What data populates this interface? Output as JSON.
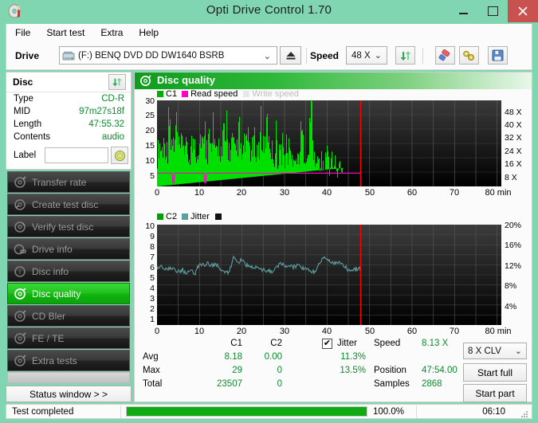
{
  "window": {
    "title": "Opti Drive Control 1.70",
    "icon": "disc-icon",
    "controls": {
      "minimize": "–",
      "maximize": "□",
      "close": "✕"
    }
  },
  "menu": {
    "items": [
      "File",
      "Start test",
      "Extra",
      "Help"
    ]
  },
  "toolbar": {
    "drive_label": "Drive",
    "drive_value": "(F:)   BENQ DVD DD DW1640 BSRB",
    "eject_title": "Eject",
    "speed_label": "Speed",
    "speed_value": "48 X",
    "refresh_icon": "refresh-icon",
    "eraser_icon": "eraser-icon",
    "tools_icon": "tools-icon",
    "save_icon": "floppy-save-icon"
  },
  "disc_panel": {
    "title": "Disc",
    "refresh_icon": "refresh-icon",
    "rows": [
      {
        "key": "Type",
        "value": "CD-R"
      },
      {
        "key": "MID",
        "value": "97m27s18f"
      },
      {
        "key": "Length",
        "value": "47:55.32"
      },
      {
        "key": "Contents",
        "value": "audio"
      }
    ],
    "label_key": "Label",
    "label_value": "",
    "label_placeholder": "",
    "label_button_icon": "cd-disc-icon"
  },
  "sidebar": {
    "items": [
      {
        "label": "Transfer rate",
        "icon": "disc-test-icon",
        "active": false
      },
      {
        "label": "Create test disc",
        "icon": "disc-burn-icon",
        "active": false
      },
      {
        "label": "Verify test disc",
        "icon": "disc-verify-icon",
        "active": false
      },
      {
        "label": "Drive info",
        "icon": "drive-info-icon",
        "active": false
      },
      {
        "label": "Disc info",
        "icon": "disc-info-icon",
        "active": false
      },
      {
        "label": "Disc quality",
        "icon": "disc-quality-icon",
        "active": true
      },
      {
        "label": "CD Bler",
        "icon": "cd-bler-icon",
        "active": false
      },
      {
        "label": "FE / TE",
        "icon": "fe-te-icon",
        "active": false
      },
      {
        "label": "Extra tests",
        "icon": "extra-tests-icon",
        "active": false
      }
    ],
    "status_window_button": "Status window > >"
  },
  "main": {
    "header_title": "Disc quality",
    "header_icon": "disc-quality-icon"
  },
  "stats": {
    "col_c1": "C1",
    "col_c2": "C2",
    "jitter_label": "Jitter",
    "jitter_checked": true,
    "jitter_check_glyph": "✔",
    "rows": [
      {
        "name": "Avg",
        "c1": "8.18",
        "c2": "0.00",
        "jitter": "11.3%"
      },
      {
        "name": "Max",
        "c1": "29",
        "c2": "0",
        "jitter": "13.5%"
      },
      {
        "name": "Total",
        "c1": "23507",
        "c2": "0",
        "jitter": ""
      }
    ],
    "speed_label": "Speed",
    "speed_value": "8.13 X",
    "position_label": "Position",
    "position_value": "47:54.00",
    "samples_label": "Samples",
    "samples_value": "2868",
    "clv_value": "8 X CLV",
    "start_full": "Start full",
    "start_part": "Start part"
  },
  "statusbar": {
    "text": "Test completed",
    "progress_pct_label": "100.0%",
    "progress_pct": 100,
    "elapsed": "06:10"
  },
  "colors": {
    "accent_green": "#00e000",
    "jitter_teal": "#5f9ea0",
    "read_speed_magenta": "#ff00c8",
    "cursor_red": "#ff0000",
    "titlebar": "#7fd6b0",
    "value_green": "#0d8a2e"
  },
  "chart_data": [
    {
      "type": "bar",
      "title": "C1 errors / Read speed",
      "id": "c1-chart",
      "xlabel": "min",
      "ylabel": "C1",
      "xlim": [
        0,
        81
      ],
      "ylim": [
        0,
        30
      ],
      "yticks": [
        5,
        10,
        15,
        20,
        25,
        30
      ],
      "y2label": "speed",
      "y2ticks": [
        "8 X",
        "16 X",
        "24 X",
        "32 X",
        "40 X",
        "48 X"
      ],
      "y2lim": [
        0,
        52
      ],
      "xticks": [
        0,
        10,
        20,
        30,
        40,
        50,
        60,
        70,
        80
      ],
      "xtick_labels": [
        "0",
        "10",
        "20",
        "30",
        "40",
        "50",
        "60",
        "70",
        "80 min"
      ],
      "legend": [
        {
          "name": "C1",
          "color": "#00c000"
        },
        {
          "name": "Read speed",
          "color": "#ff00c8"
        },
        {
          "name": "Write speed",
          "color": "#e6e6e6"
        }
      ],
      "cursor_x": 47.9,
      "data_end_x": 47.9,
      "read_speed_series": {
        "name": "Read speed",
        "constant_value": 4.6,
        "dips_at": [
          3.9,
          11.4
        ]
      },
      "categories": [
        0.0,
        0.4,
        0.8,
        1.2,
        1.6,
        2.0,
        2.4,
        2.8,
        3.2,
        3.6,
        4.0,
        4.4,
        4.8,
        5.2,
        5.6,
        6.0,
        6.4,
        6.8,
        7.2,
        7.6,
        8.0,
        8.4,
        8.8,
        9.2,
        9.6,
        10.0,
        10.4,
        10.8,
        11.2,
        11.6,
        12.0,
        12.4,
        12.8,
        13.2,
        13.6,
        14.0,
        14.4,
        14.8,
        15.2,
        15.6,
        16.0,
        16.4,
        16.8,
        17.2,
        17.6,
        18.0,
        18.4,
        18.8,
        19.2,
        19.6,
        20.0,
        20.4,
        20.8,
        21.2,
        21.6,
        22.0,
        22.4,
        22.8,
        23.2,
        23.6,
        24.0,
        24.4,
        24.8,
        25.2,
        25.6,
        26.0,
        26.4,
        26.8,
        27.2,
        27.6,
        28.0,
        28.4,
        28.8,
        29.2,
        29.6,
        30.0,
        30.4,
        30.8,
        31.2,
        31.6,
        32.0,
        32.4,
        32.8,
        33.2,
        33.6,
        34.0,
        34.4,
        34.8,
        35.2,
        35.6,
        36.0,
        36.4,
        36.8,
        37.2,
        37.6,
        38.0,
        38.4,
        38.8,
        39.2,
        39.6,
        40.0,
        40.4,
        40.8,
        41.2,
        41.6,
        42.0,
        42.4,
        42.8,
        43.2,
        43.6,
        44.0,
        44.4,
        44.8,
        45.2,
        45.6,
        46.0,
        46.4,
        46.8,
        47.2,
        47.6
      ],
      "values": [
        12,
        18,
        16,
        15,
        19,
        17,
        14,
        27,
        16,
        20,
        13,
        27,
        18,
        14,
        16,
        20,
        17,
        15,
        13,
        12,
        18,
        16,
        20,
        14,
        16,
        19,
        23,
        15,
        18,
        16,
        14,
        17,
        13,
        21,
        11,
        15,
        18,
        16,
        13,
        23,
        17,
        21,
        15,
        14,
        19,
        16,
        13,
        17,
        21,
        15,
        12,
        16,
        20,
        14,
        18,
        15,
        13,
        19,
        17,
        14,
        16,
        22,
        18,
        13,
        23,
        25,
        21,
        16,
        14,
        12,
        18,
        11,
        16,
        13,
        15,
        10,
        17,
        12,
        14,
        11,
        13,
        15,
        10,
        12,
        16,
        24,
        17,
        14,
        12,
        10,
        29,
        24,
        13,
        11,
        9,
        12,
        8,
        10,
        7,
        9,
        11,
        8,
        6,
        10,
        7,
        9,
        5,
        8,
        6,
        7
      ],
      "summary": {
        "avg": 8.18,
        "max": 29,
        "total": 23507
      }
    },
    {
      "type": "line",
      "title": "C2 errors / Jitter",
      "id": "c2-jitter-chart",
      "xlabel": "min",
      "ylabel": "C2",
      "xlim": [
        0,
        81
      ],
      "ylim": [
        0,
        10
      ],
      "yticks": [
        1,
        2,
        3,
        4,
        5,
        6,
        7,
        8,
        9,
        10
      ],
      "y2label": "jitter %",
      "y2ticks": [
        "4%",
        "8%",
        "12%",
        "16%",
        "20%"
      ],
      "y2lim": [
        0,
        20
      ],
      "xticks": [
        0,
        10,
        20,
        30,
        40,
        50,
        60,
        70,
        80
      ],
      "xtick_labels": [
        "0",
        "10",
        "20",
        "30",
        "40",
        "50",
        "60",
        "70",
        "80 min"
      ],
      "legend": [
        {
          "name": "C2",
          "color": "#00a000"
        },
        {
          "name": "Jitter",
          "color": "#5f9ea0"
        }
      ],
      "cursor_x": 47.9,
      "series": [
        {
          "name": "C2",
          "values": []
        },
        {
          "name": "Jitter",
          "x": [
            0,
            1,
            2,
            3,
            4,
            5,
            6,
            7,
            8,
            9,
            10,
            11,
            12,
            13,
            14,
            15,
            16,
            17,
            18,
            19,
            20,
            21,
            22,
            23,
            24,
            25,
            26,
            27,
            28,
            29,
            30,
            31,
            32,
            33,
            34,
            35,
            36,
            37,
            38,
            39,
            40,
            41,
            42,
            43,
            44,
            45,
            46,
            47,
            47.9
          ],
          "values": [
            5.7,
            5.9,
            5.6,
            5.7,
            5.6,
            5.3,
            5.5,
            5.1,
            5.4,
            5.2,
            6.1,
            6.0,
            6.1,
            5.9,
            6.0,
            5.6,
            5.2,
            5.3,
            6.7,
            6.2,
            6.5,
            6.0,
            5.9,
            5.7,
            5.6,
            5.5,
            5.4,
            5.3,
            5.6,
            6.1,
            5.9,
            6.0,
            5.8,
            5.9,
            5.7,
            5.6,
            5.5,
            5.2,
            5.9,
            6.8,
            6.4,
            6.2,
            6.1,
            6.3,
            5.9,
            5.5,
            5.4,
            5.6,
            5.6
          ]
        }
      ],
      "summary": {
        "avg_pct": "11.3%",
        "max_pct": "13.5%"
      }
    }
  ]
}
